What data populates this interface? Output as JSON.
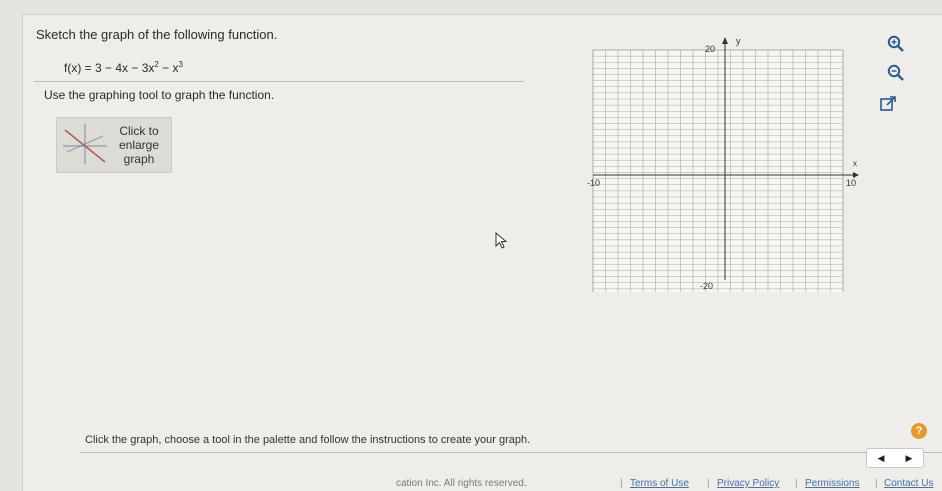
{
  "question": {
    "title": "Sketch the graph of the following function.",
    "fx_prefix": "f(x) = 3 − 4x − 3x",
    "fx_exp1": "2",
    "fx_mid": " − x",
    "fx_exp2": "3",
    "instruction": "Use the graphing tool to graph the function."
  },
  "enlarge_button": {
    "line1": "Click to",
    "line2": "enlarge",
    "line3": "graph"
  },
  "graph": {
    "x_axis_label": "x",
    "y_axis_label": "y",
    "x_min_label": "-10",
    "x_max_label": "10",
    "y_max_label": "20",
    "y_min_label": "-20",
    "x_range": [
      -10,
      10
    ],
    "y_range": [
      -20,
      20
    ],
    "grid": true
  },
  "tools": {
    "zoom_in": "zoom-in-icon",
    "zoom_out": "zoom-out-icon",
    "popout": "popout-icon"
  },
  "footer": {
    "instruction": "Click the graph, choose a tool in the palette and follow the instructions to create your graph.",
    "help": "?",
    "prev": "◀",
    "next": "▶"
  },
  "bottom_bar": {
    "copyright": "cation Inc. All rights reserved.",
    "terms": "Terms of Use",
    "privacy": "Privacy Policy",
    "permissions": "Permissions",
    "contact": "Contact Us",
    "separator": "|"
  },
  "colors": {
    "background": "#e4e3de",
    "help": "#e39a2d",
    "link": "#4a6fa5"
  }
}
